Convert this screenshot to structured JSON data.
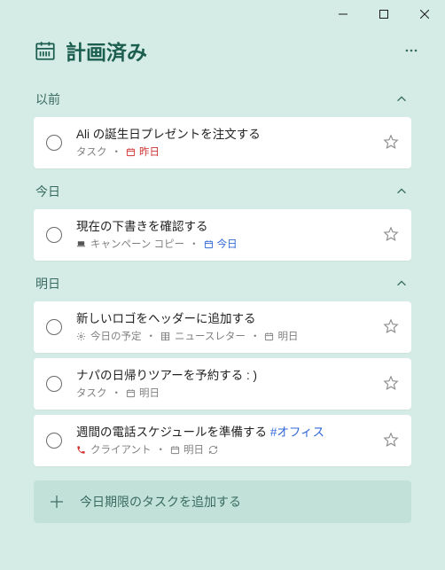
{
  "header": {
    "title": "計画済み"
  },
  "sections": [
    {
      "title": "以前",
      "tasks": [
        {
          "title": "Ali の誕生日プレゼントを注文する",
          "list": "タスク",
          "due_label": "昨日",
          "due_color": "red",
          "extras": []
        }
      ]
    },
    {
      "title": "今日",
      "tasks": [
        {
          "title": "現在の下書きを確認する",
          "list_icon": "laptop",
          "list": "キャンペーン コピー",
          "due_label": "今日",
          "due_color": "blue",
          "extras": []
        }
      ]
    },
    {
      "title": "明日",
      "tasks": [
        {
          "title": "新しいロゴをヘッダーに追加する",
          "list_icon": "sun",
          "list": "今日の予定",
          "mid_icon": "grid",
          "mid_label": "ニュースレター",
          "due_label": "明日",
          "due_color": "grey",
          "extras": []
        },
        {
          "title": "ナパの日帰りツアーを予約する : )",
          "list": "タスク",
          "due_label": "明日",
          "due_color": "grey",
          "extras": []
        },
        {
          "title_pre": "週間の電話スケジュールを準備する ",
          "title_tag": "#オフィス",
          "list_icon": "phone-red",
          "list": "クライアント",
          "due_label": "明日",
          "due_color": "grey",
          "extras": [
            "repeat"
          ]
        }
      ]
    }
  ],
  "addbar": {
    "placeholder": "今日期限のタスクを追加する"
  }
}
